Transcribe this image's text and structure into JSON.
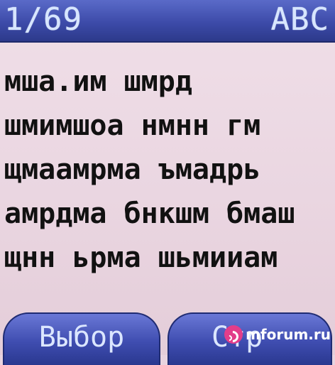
{
  "status": {
    "counter": "1/69",
    "input_mode": "ABC"
  },
  "message": {
    "lines": [
      "мша.им шмрд",
      "шмимшоа нмнн гм",
      "щмаамрма ъмадрь",
      "амрдма бнкшм бмаш",
      "щнн ьрма шьмииам"
    ]
  },
  "softkeys": {
    "left": "Выбор",
    "right": "Стр"
  },
  "watermark": {
    "text": "mforum.ru"
  },
  "colors": {
    "bar": "#3c4aa8",
    "background": "#ead6e1",
    "text": "#111111",
    "watermark_accent": "#e23d8a"
  }
}
